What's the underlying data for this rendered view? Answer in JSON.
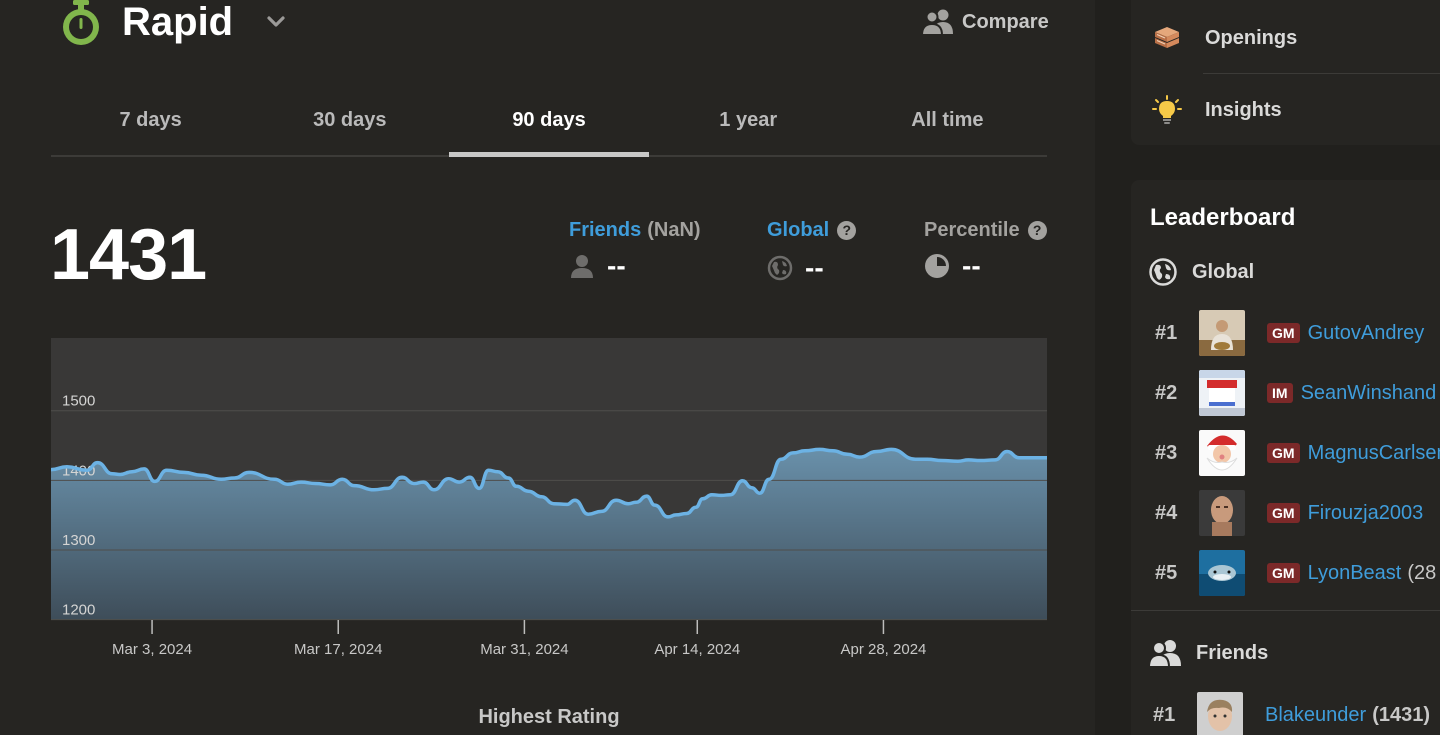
{
  "header": {
    "title": "Rapid",
    "compare_label": "Compare"
  },
  "tabs": [
    {
      "label": "7 days",
      "active": false
    },
    {
      "label": "30 days",
      "active": false
    },
    {
      "label": "90 days",
      "active": true
    },
    {
      "label": "1 year",
      "active": false
    },
    {
      "label": "All time",
      "active": false
    }
  ],
  "rating": "1431",
  "stats": {
    "friends_label": "Friends",
    "friends_count": "(NaN)",
    "friends_value": "--",
    "global_label": "Global",
    "global_value": "--",
    "percentile_label": "Percentile",
    "percentile_value": "--",
    "help_glyph": "?"
  },
  "chart_caption": "Highest Rating",
  "chart_data": {
    "type": "area",
    "ylim": [
      1175,
      1580
    ],
    "yticks": [
      1500,
      1400,
      1300,
      1200
    ],
    "xtick_labels": [
      "Mar 3, 2024",
      "Mar 17, 2024",
      "Mar 31, 2024",
      "Apr 14, 2024",
      "Apr 28, 2024"
    ],
    "xtick_days": [
      0,
      14,
      28,
      41,
      55
    ],
    "xlim_days": [
      -7.6,
      67.3
    ],
    "series": [
      {
        "x_days": [
          -7.6,
          -6.4,
          -4.9,
          -4.1,
          -3.0,
          -2.4,
          -1.5,
          -0.6,
          0.2,
          1.1,
          2.4,
          3.7,
          5.2,
          6.2,
          7.3,
          9.2,
          10.2,
          11.2,
          12.3,
          13.4,
          14.3,
          15.2,
          16.7,
          17.7,
          18.8,
          19.7,
          20.4,
          21.2,
          22.3,
          23.1,
          23.9,
          24.6,
          25.3,
          26.0,
          26.8,
          27.4,
          28.3,
          29.3,
          30.2,
          31.2,
          31.8,
          32.8,
          33.8,
          34.9,
          35.8,
          36.4,
          37.2,
          37.8,
          38.8,
          39.4,
          40.2,
          40.9,
          41.4,
          42.1,
          42.8,
          43.5,
          44.4,
          45.1,
          45.7,
          46.4,
          47.3,
          48.2,
          49.1,
          50.2,
          51.2,
          52.3,
          53.2,
          54.5,
          55.6,
          57.4,
          58.3,
          59.4,
          60.6,
          61.4,
          62.3,
          63.4,
          64.3,
          65.2,
          66.3,
          67.3
        ],
        "values": [
          1391,
          1395,
          1390,
          1401,
          1385,
          1384,
          1388,
          1392,
          1374,
          1390,
          1387,
          1383,
          1377,
          1379,
          1387,
          1377,
          1370,
          1373,
          1371,
          1369,
          1377,
          1368,
          1362,
          1364,
          1380,
          1371,
          1373,
          1362,
          1378,
          1373,
          1380,
          1364,
          1390,
          1388,
          1379,
          1367,
          1360,
          1352,
          1342,
          1341,
          1347,
          1327,
          1331,
          1347,
          1342,
          1344,
          1353,
          1340,
          1323,
          1326,
          1328,
          1337,
          1349,
          1355,
          1354,
          1355,
          1375,
          1365,
          1357,
          1377,
          1406,
          1415,
          1418,
          1420,
          1418,
          1413,
          1409,
          1417,
          1420,
          1406,
          1406,
          1404,
          1403,
          1405,
          1404,
          1405,
          1417,
          1408,
          1408,
          1408
        ]
      }
    ],
    "colors": {
      "line": "#6cb2e4",
      "fill_top": "#6990aa",
      "fill_bottom": "#3e4d59",
      "plot_bg": "#393837",
      "grid": "#4f4e4b"
    }
  },
  "sidebar": {
    "menu": [
      {
        "label": "Openings",
        "icon": "book-stack-icon"
      },
      {
        "label": "Insights",
        "icon": "lightbulb-icon"
      }
    ],
    "leaderboard_title": "Leaderboard",
    "global_label": "Global",
    "global": [
      {
        "rank": "#1",
        "title": "GM",
        "name": "GutovAndrey",
        "rating": ""
      },
      {
        "rank": "#2",
        "title": "IM",
        "name": "SeanWinshand",
        "rating": ""
      },
      {
        "rank": "#3",
        "title": "GM",
        "name": "MagnusCarlsen",
        "rating": ""
      },
      {
        "rank": "#4",
        "title": "GM",
        "name": "Firouzja2003",
        "rating": ""
      },
      {
        "rank": "#5",
        "title": "GM",
        "name": "LyonBeast",
        "rating": "(28"
      }
    ],
    "friends_label": "Friends",
    "friends": [
      {
        "rank": "#1",
        "name": "Blakeunder",
        "rating": "(1431)"
      }
    ]
  }
}
